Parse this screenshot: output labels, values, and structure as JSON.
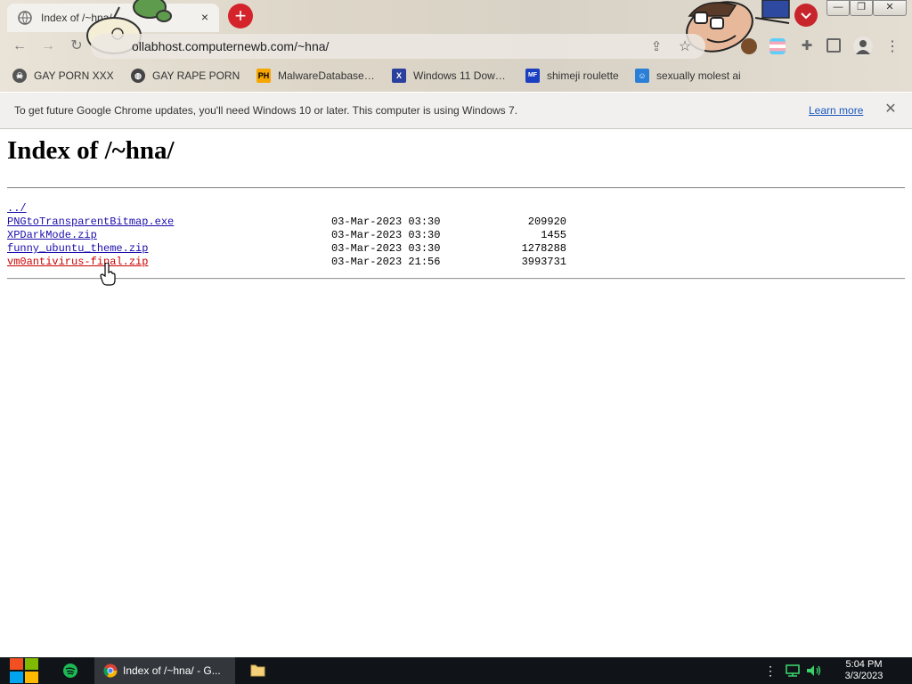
{
  "browser": {
    "tab_title": "Index of /~hna/",
    "url": "ollabhost.computernewb.com/~hna/",
    "new_tab_label": "+",
    "tab_close_label": "×",
    "window_controls": {
      "minimize": "—",
      "maximize": "❐",
      "close": "✕"
    },
    "bookmarks": [
      {
        "label": "GAY PORN XXX",
        "icon": "skull-icon"
      },
      {
        "label": "GAY RAPE PORN",
        "icon": "globe-icon"
      },
      {
        "label": "MalwareDatabase…",
        "icon": "ph-icon"
      },
      {
        "label": "Windows 11 Dow…",
        "icon": "x-icon"
      },
      {
        "label": "shimeji roulette",
        "icon": "mft-icon"
      },
      {
        "label": "sexually molest ai",
        "icon": "bot-icon"
      }
    ]
  },
  "infobar": {
    "text": "To get future Google Chrome updates, you'll need Windows 10 or later. This computer is using Windows 7.",
    "learn_more": "Learn more",
    "close": "✕"
  },
  "page": {
    "title": "Index of /~hna/",
    "parent_link": "../",
    "files": [
      {
        "name": "PNGtoTransparentBitmap.exe",
        "date": "03-Mar-2023 03:30",
        "size": "209920"
      },
      {
        "name": "XPDarkMode.zip",
        "date": "03-Mar-2023 03:30",
        "size": "1455"
      },
      {
        "name": "funny_ubuntu_theme.zip",
        "date": "03-Mar-2023 03:30",
        "size": "1278288"
      },
      {
        "name": "vm0antivirus-final.zip",
        "date": "03-Mar-2023 21:56",
        "size": "3993731"
      }
    ]
  },
  "taskbar": {
    "chrome_label": "Index of /~hna/ - G...",
    "time": "5:04 PM",
    "date": "3/3/2023"
  },
  "colors": {
    "link": "#1a0dab",
    "hover_link": "#cc0000",
    "taskbar": "#101418",
    "accent_red": "#d4232b"
  }
}
